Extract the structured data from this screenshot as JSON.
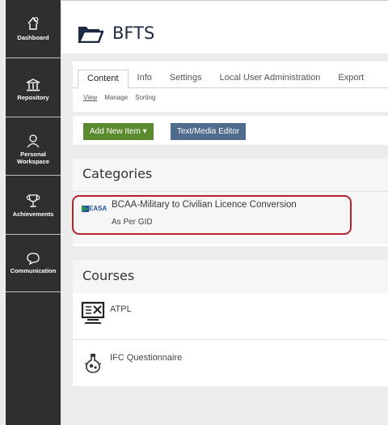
{
  "sidebar": {
    "items": [
      {
        "label": "Dashboard",
        "icon": "dashboard-icon"
      },
      {
        "label": "Repository",
        "icon": "bank-icon"
      },
      {
        "label": "Personal Workspace",
        "icon": "person-icon"
      },
      {
        "label": "Achievements",
        "icon": "trophy-icon"
      },
      {
        "label": "Communication",
        "icon": "chat-icon"
      }
    ]
  },
  "header": {
    "title": "BFTS",
    "icon": "folder-open-icon"
  },
  "tabs": [
    {
      "label": "Content",
      "active": true
    },
    {
      "label": "Info"
    },
    {
      "label": "Settings"
    },
    {
      "label": "Local User Administration"
    },
    {
      "label": "Export"
    }
  ],
  "subtabs": [
    {
      "label": "View",
      "active": true
    },
    {
      "label": "Manage"
    },
    {
      "label": "Sorting"
    }
  ],
  "toolbar": {
    "add_item_label": "Add New Item ▾",
    "editor_label": "Text/Media Editor"
  },
  "categories": {
    "heading": "Categories",
    "items": [
      {
        "logo_text": "EASA",
        "title": "BCAA-Military to Civilian Licence Conversion",
        "description": "As Per GID"
      }
    ]
  },
  "courses": {
    "heading": "Courses",
    "items": [
      {
        "title": "ATPL",
        "icon": "course-computer-icon"
      },
      {
        "title": "IFC Questionnaire",
        "icon": "flask-icon"
      }
    ]
  },
  "colors": {
    "sidebar_bg": "#2f2f2f",
    "add_button": "#5c8a2e",
    "editor_button": "#4f6b8d",
    "highlight": "#b5232d",
    "title": "#1d2a44"
  }
}
